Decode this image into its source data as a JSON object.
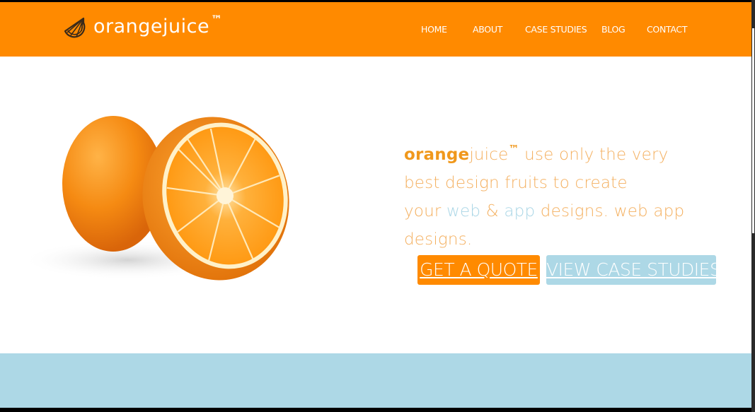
{
  "brand": {
    "name": "orangejuice",
    "name_bold_part": "orange",
    "name_light_part": "juice",
    "trademark": "™"
  },
  "nav": {
    "items": [
      {
        "label": "HOME"
      },
      {
        "label": "ABOUT"
      },
      {
        "label": "CASE STUDIES"
      },
      {
        "label": "BLOG"
      },
      {
        "label": "CONTACT"
      }
    ]
  },
  "hero": {
    "image_alt": "orange-fruit-halves",
    "tagline": {
      "line1_rest": " use only the very",
      "line2": "best design fruits to create",
      "line3_prefix": "your ",
      "line3_web": "web",
      "line3_amp": " & ",
      "line3_app": "app",
      "line3_suffix": " designs. web app",
      "line4": "designs."
    },
    "buttons": {
      "quote_label": "GET A QUOTE",
      "cases_label": "VIEW CASE STUDIES"
    }
  },
  "colors": {
    "brand_orange": "#ff8a00",
    "accent_blue": "#add8e6",
    "text_orange": "#f4b060"
  },
  "icons": {
    "logo": "orange-slice-icon"
  }
}
